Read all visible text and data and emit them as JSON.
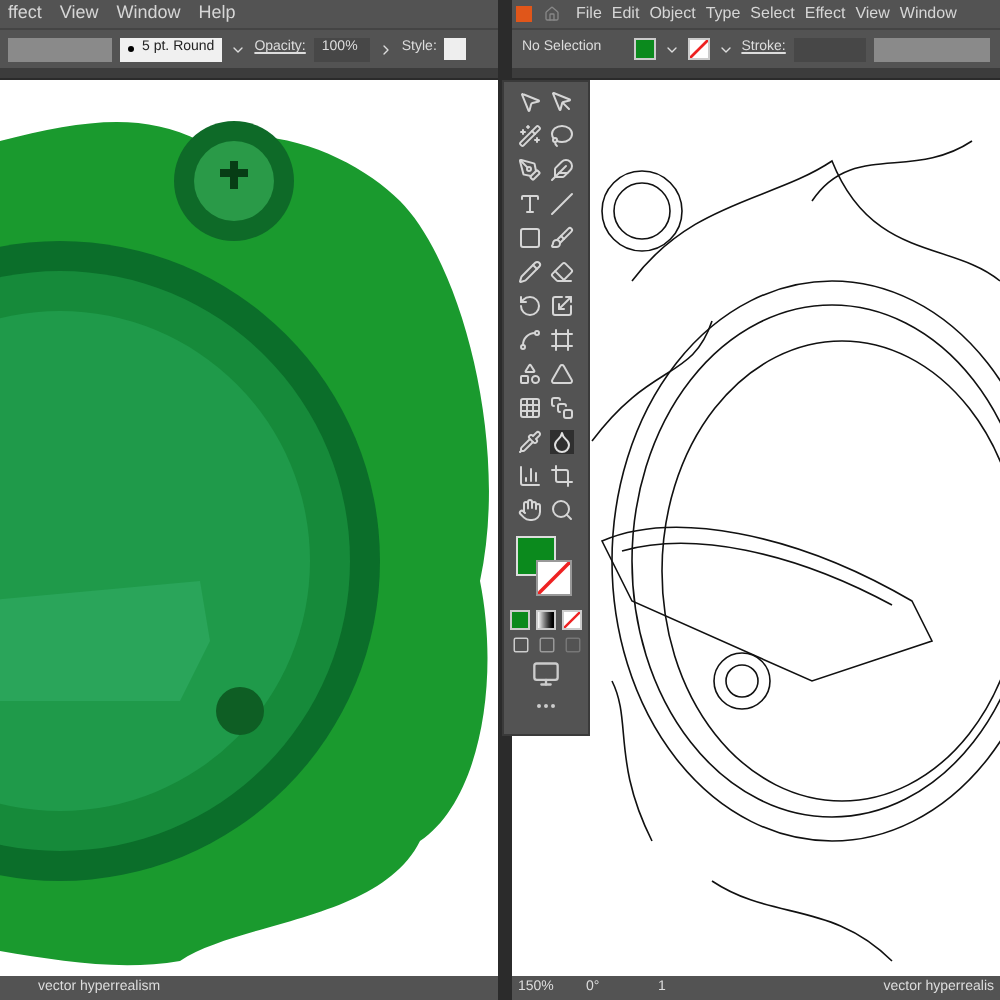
{
  "left_window": {
    "menu": [
      "ffect",
      "View",
      "Window",
      "Help"
    ],
    "control_bar": {
      "brush": "5 pt. Round",
      "opacity_label": "Opacity:",
      "opacity": "100%",
      "style_label": "Style:"
    },
    "status_bar": {
      "document": "vector hyperrealism"
    }
  },
  "right_window": {
    "menu": [
      "File",
      "Edit",
      "Object",
      "Type",
      "Select",
      "Effect",
      "View",
      "Window"
    ],
    "control_bar": {
      "selection": "No Selection",
      "stroke_label": "Stroke:"
    },
    "status_bar": {
      "zoom": "150%",
      "rotation": "0°",
      "artboard": "1",
      "document": "vector hyperrealis"
    }
  }
}
